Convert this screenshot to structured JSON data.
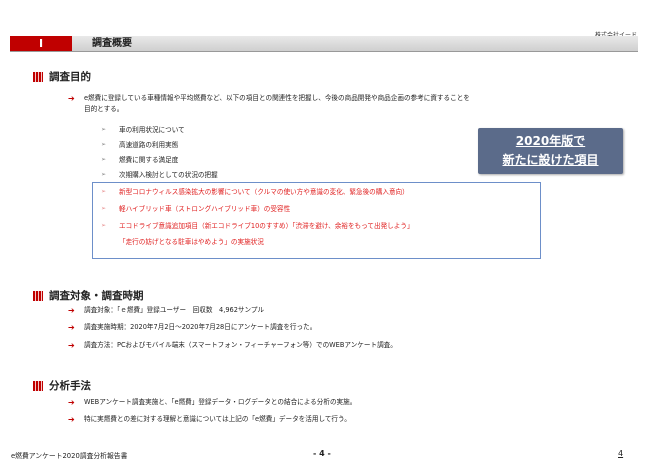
{
  "company": "株式会社イード",
  "header": {
    "number": "I",
    "title": "調査概要"
  },
  "section1": {
    "title": "調査目的",
    "intro_line1": "e燃費に登録している車種情報や平均燃費など、以下の項目との関連性を把握し、今後の商品開発や商品企画の参考に資することを",
    "intro_line2": "目的とする。",
    "items": [
      "車の利用状況について",
      "高速道路の利用実態",
      "燃費に関する満足度",
      "次期購入検討としての状況の把握"
    ],
    "new_items": [
      "新型コロナウィルス感染拡大の影響について（クルマの使い方や意識の変化、緊急後の購入意向）",
      "軽ハイブリッド車（ストロングハイブリッド車）の受容性",
      "エコドライブ意識追加項目（新エコドライブ10のすすめ）「渋滞を避け、余裕をもって出発しよう」",
      "「走行の妨げとなる駐車はやめよう」の実施状況"
    ]
  },
  "callout": {
    "line1": "2020年版で",
    "line2": "新たに設けた項目"
  },
  "section2": {
    "title": "調査対象・調査時期",
    "items": [
      "調査対象：「ｅ燃費」登録ユーザー　回収数　4,962サンプル",
      "調査実施時期：2020年7月2日～2020年7月28日にアンケート調査を行った。",
      "調査方法：PCおよびモバイル端末（スマートフォン・フィーチャーフォン等）でのWEBアンケート調査。"
    ]
  },
  "section3": {
    "title": "分析手法",
    "items": [
      "WEBアンケート調査実施と、「e燃費」登録データ・ログデータとの結合による分析の実施。",
      "特に実燃費との差に対する理解と意識については上記の「e燃費」データを活用して行う。"
    ]
  },
  "footer": {
    "left": "e燃費アンケート2020調査分析報告書",
    "center": "- 4 -",
    "right": "4"
  },
  "colors": {
    "accent_red": "#c00000",
    "callout_bg": "#5b6b8a",
    "box_border": "#6d8fc9"
  }
}
